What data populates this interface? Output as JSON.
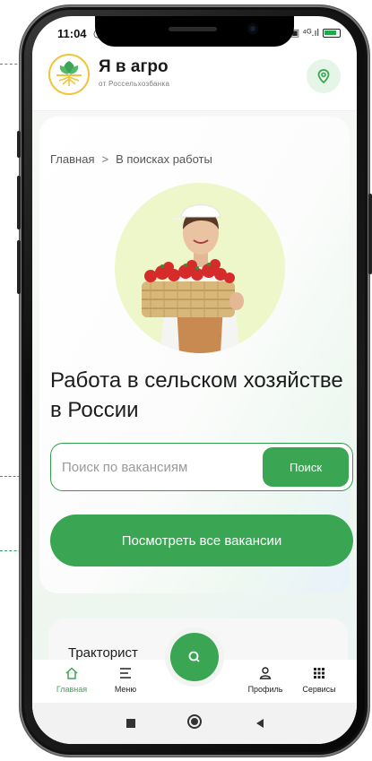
{
  "status": {
    "time": "11:04",
    "left_icons": "◷ ◢",
    "right_icons": "▣ ⁴ᴳ.ıl"
  },
  "header": {
    "title": "Я в агро",
    "subtitle": "от Россельхозбанка"
  },
  "breadcrumb": {
    "home": "Главная",
    "separator": ">",
    "current": "В поисках работы"
  },
  "hero": {
    "title": "Работа в сельском хозяйстве в России"
  },
  "search": {
    "placeholder": "Поиск по вакансиям",
    "button": "Поиск"
  },
  "actions": {
    "all_vacancies": "Посмотреть все вакансии"
  },
  "job_card": {
    "title": "Тракторист"
  },
  "bottom_nav": {
    "items": [
      {
        "label": "Главная",
        "icon": "home-icon",
        "active": true
      },
      {
        "label": "Меню",
        "icon": "menu-icon"
      },
      {
        "label": "Профиль",
        "icon": "profile-icon"
      },
      {
        "label": "Сервисы",
        "icon": "grid-icon"
      }
    ],
    "fab_icon": "search-icon"
  },
  "colors": {
    "accent": "#3aa653",
    "accent_light": "#e5f5e7",
    "hero_circle": "#eef7c9"
  }
}
